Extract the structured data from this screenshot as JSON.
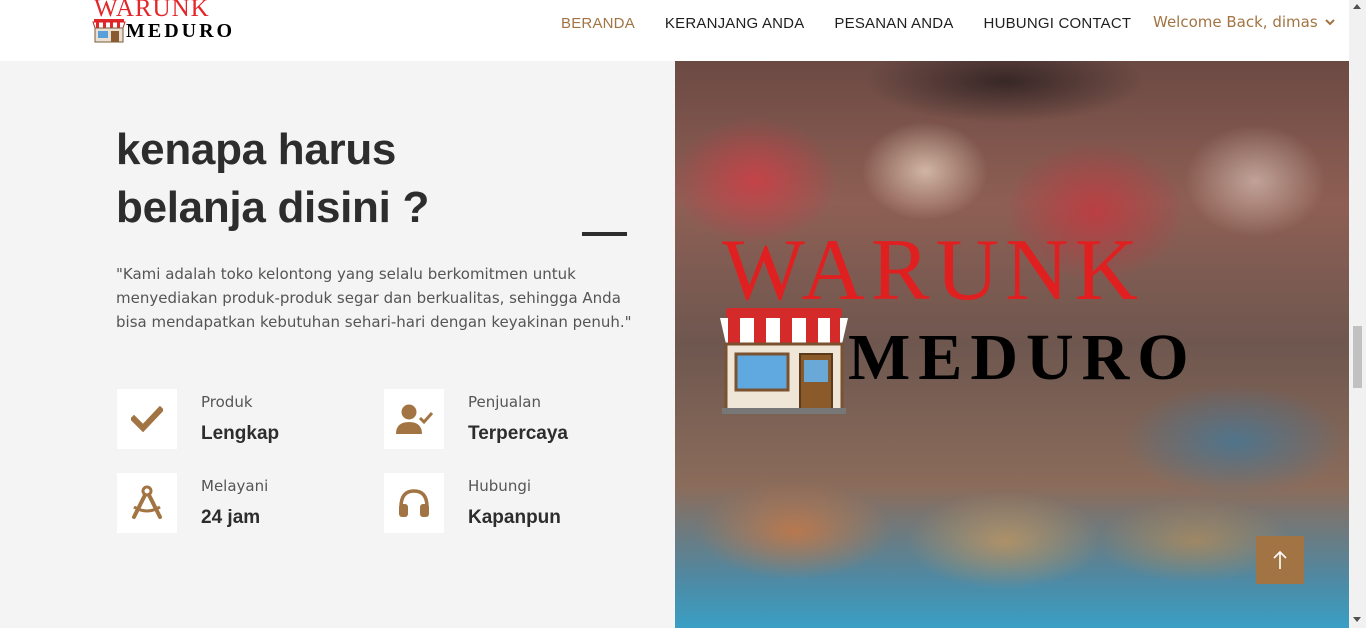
{
  "brand": {
    "logo_top": "WARUNK",
    "logo_bottom": "MEDURO"
  },
  "nav": {
    "items": [
      {
        "label": "BERANDA",
        "active": true
      },
      {
        "label": "KERANJANG ANDA",
        "active": false
      },
      {
        "label": "PESANAN ANDA",
        "active": false
      },
      {
        "label": "HUBUNGI CONTACT",
        "active": false
      }
    ],
    "welcome": "Welcome Back, dimas",
    "welcome_icon": "chevron-down-icon"
  },
  "about": {
    "heading_line1": "kenapa harus",
    "heading_line2": "belanja disini ?",
    "description": "\"Kami adalah toko kelontong yang selalu berkomitmen untuk menyediakan produk-produk segar dan berkualitas, sehingga Anda bisa mendapatkan kebutuhan sehari-hari dengan keyakinan penuh.\"",
    "features": [
      {
        "label": "Produk",
        "value": "Lengkap",
        "icon": "check-icon"
      },
      {
        "label": "Penjualan",
        "value": "Terpercaya",
        "icon": "user-check-icon"
      },
      {
        "label": "Melayani",
        "value": "24 jam",
        "icon": "compass-drafting-icon"
      },
      {
        "label": "Hubungi",
        "value": "Kapanpun",
        "icon": "headphones-icon"
      }
    ]
  },
  "hero": {
    "logo_top": "WARUNK",
    "logo_bottom": "MEDURO"
  },
  "colors": {
    "accent": "#a37443",
    "heading": "#2d2d2d",
    "logo_red": "#e3262a"
  }
}
